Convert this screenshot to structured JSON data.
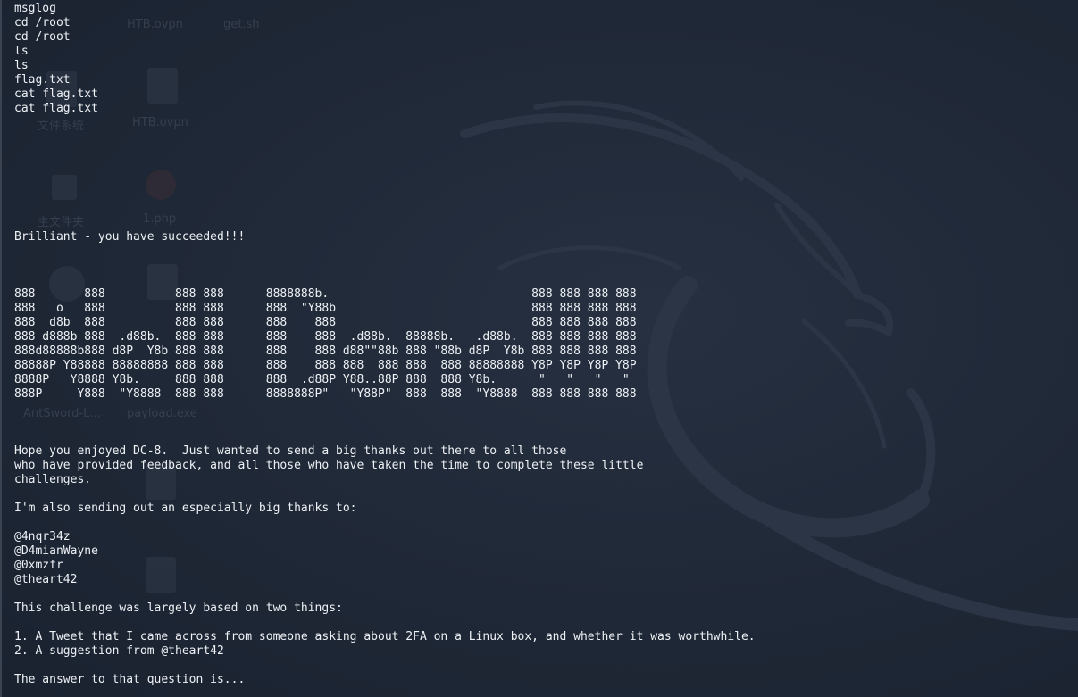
{
  "desktop": {
    "icon_labels": [
      "HTB.ovpn",
      "get.sh",
      "文件系统",
      "HTB.ovpn",
      "主文件夹",
      "1.php",
      "AntSword-L...",
      "payload.exe"
    ]
  },
  "terminal": {
    "lines": [
      "msglog",
      "cd /root",
      "cd /root",
      "ls",
      "ls",
      "flag.txt",
      "cat flag.txt",
      "cat flag.txt",
      "",
      "",
      "",
      "",
      "",
      "",
      "",
      "",
      "Brilliant - you have succeeded!!!",
      "",
      "",
      "",
      "888       888          888 888      8888888b.                             888 888 888 888",
      "888   o   888          888 888      888  \"Y88b                            888 888 888 888",
      "888  d8b  888          888 888      888    888                            888 888 888 888",
      "888 d888b 888  .d88b.  888 888      888    888  .d88b.  88888b.   .d88b.  888 888 888 888",
      "888d88888b888 d8P  Y8b 888 888      888    888 d88\"\"88b 888 \"88b d8P  Y8b 888 888 888 888",
      "88888P Y88888 88888888 888 888      888    888 888  888 888  888 88888888 Y8P Y8P Y8P Y8P",
      "8888P   Y8888 Y8b.     888 888      888  .d88P Y88..88P 888  888 Y8b.      \"   \"   \"   \"",
      "888P     Y888  \"Y8888  888 888      8888888P\"   \"Y88P\"  888  888  \"Y8888  888 888 888 888",
      "",
      "",
      "",
      "Hope you enjoyed DC-8.  Just wanted to send a big thanks out there to all those",
      "who have provided feedback, and all those who have taken the time to complete these little",
      "challenges.",
      "",
      "I'm also sending out an especially big thanks to:",
      "",
      "@4nqr34z",
      "@D4mianWayne",
      "@0xmzfr",
      "@theart42",
      "",
      "This challenge was largely based on two things:",
      "",
      "1. A Tweet that I came across from someone asking about 2FA on a Linux box, and whether it was worthwhile.",
      "2. A suggestion from @theart42",
      "",
      "The answer to that question is..."
    ]
  }
}
